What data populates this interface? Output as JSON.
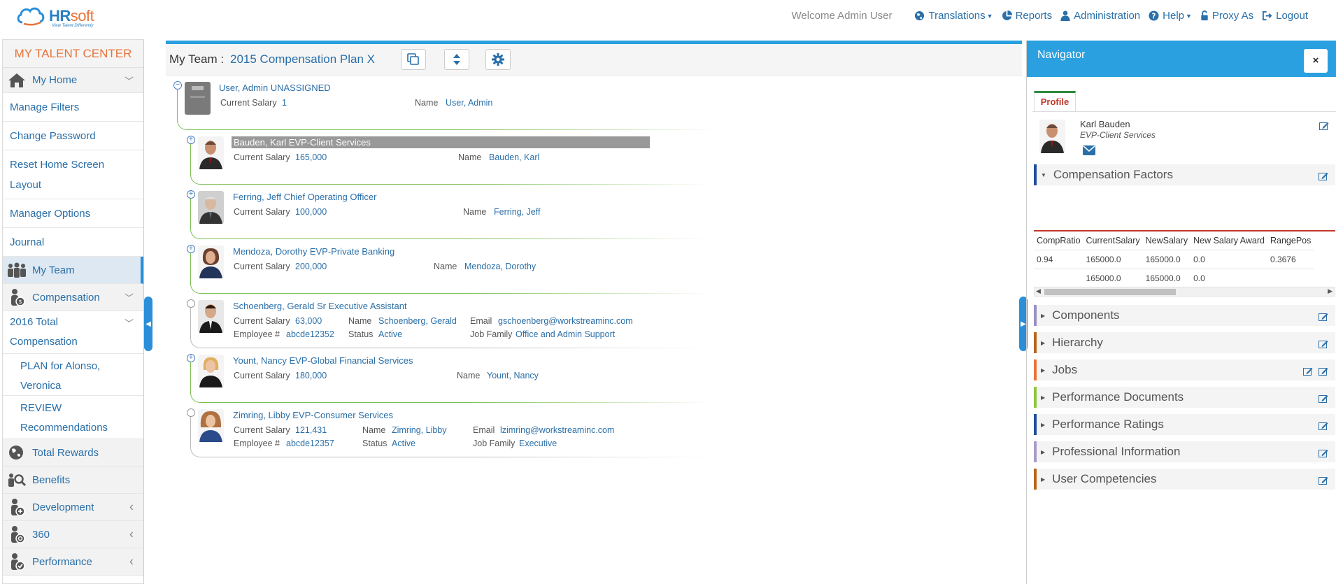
{
  "header": {
    "logo_brand": "HRsoft",
    "logo_hr": "HR",
    "logo_soft": "soft",
    "logo_tagline": "View Talent Differently",
    "welcome": "Welcome Admin User",
    "translations": "Translations",
    "reports": "Reports",
    "administration": "Administration",
    "help": "Help",
    "proxy_as": "Proxy As",
    "logout": "Logout"
  },
  "sidebar": {
    "title": "MY TALENT CENTER",
    "my_home": "My Home",
    "manage_filters": "Manage Filters",
    "change_password": "Change Password",
    "reset_home_1": "Reset Home Screen",
    "reset_home_2": "Layout",
    "manager_options": "Manager Options",
    "journal": "Journal",
    "my_team": "My Team",
    "compensation": "Compensation",
    "total_comp_1": "2016 Total",
    "total_comp_2": "Compensation",
    "plan_1": "PLAN for Alonso,",
    "plan_2": "Veronica",
    "review_1": "REVIEW",
    "review_2": "Recommendations",
    "total_rewards": "Total Rewards",
    "benefits": "Benefits",
    "development": "Development",
    "three_sixty": "360",
    "performance": "Performance"
  },
  "main": {
    "team_label": "My Team :",
    "plan_name": "2015 Compensation Plan X"
  },
  "labels": {
    "current_salary": "Current Salary",
    "name": "Name",
    "email": "Email",
    "employee_no": "Employee #",
    "status": "Status",
    "job_family": "Job Family"
  },
  "team": {
    "root": {
      "title": "User, Admin  UNASSIGNED",
      "salary": "1",
      "name": "User, Admin"
    },
    "bauden": {
      "title": "Bauden, Karl  EVP-Client Services",
      "salary": "165,000",
      "name": "Bauden, Karl"
    },
    "ferring": {
      "title": "Ferring, Jeff  Chief Operating Officer",
      "salary": "100,000",
      "name": "Ferring, Jeff"
    },
    "mendoza": {
      "title": "Mendoza, Dorothy  EVP-Private Banking",
      "salary": "200,000",
      "name": "Mendoza, Dorothy"
    },
    "schoenberg": {
      "title": "Schoenberg, Gerald  Sr Executive Assistant",
      "salary": "63,000",
      "name": "Schoenberg, Gerald",
      "email": "gschoenberg@workstreaminc.com",
      "employee_no": "abcde12352",
      "status": "Active",
      "job_family": "Office and Admin Support"
    },
    "yount": {
      "title": "Yount, Nancy  EVP-Global Financial Services",
      "salary": "180,000",
      "name": "Yount, Nancy"
    },
    "zimring": {
      "title": "Zimring, Libby  EVP-Consumer Services",
      "salary": "121,431",
      "name": "Zimring, Libby",
      "email": "lzimring@workstreaminc.com",
      "employee_no": "abcde12357",
      "status": "Active",
      "job_family": "Executive"
    }
  },
  "navigator": {
    "title": "Navigator",
    "close": "×",
    "profile_tab": "Profile",
    "profile_name": "Karl  Bauden",
    "profile_title": "EVP-Client Services",
    "sections": {
      "compensation_factors": "Compensation Factors",
      "components": "Components",
      "hierarchy": "Hierarchy",
      "jobs": "Jobs",
      "performance_documents": "Performance Documents",
      "performance_ratings": "Performance Ratings",
      "professional_information": "Professional Information",
      "user_competencies": "User Competencies"
    },
    "comp_table": {
      "headers": [
        "CompRatio",
        "CurrentSalary",
        "NewSalary",
        "New Salary Award",
        "RangePos"
      ],
      "rows": [
        [
          "0.94",
          "165000.0",
          "165000.0",
          "0.0",
          "0.3676"
        ],
        [
          "",
          "165000.0",
          "165000.0",
          "0.0",
          ""
        ]
      ]
    }
  },
  "colors": {
    "brand_blue": "#2aa0e0",
    "link_blue": "#2a6fa8",
    "orange": "#e8733a",
    "tree_green": "#7cbf55"
  }
}
